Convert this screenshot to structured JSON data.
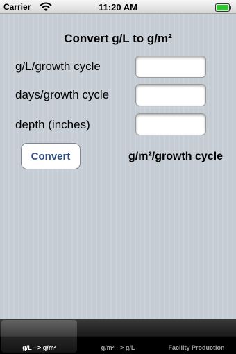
{
  "status_bar": {
    "carrier": "Carrier",
    "time": "11:20 AM",
    "icons": [
      "wifi-icon",
      "battery-icon"
    ]
  },
  "form": {
    "title": "Convert g/L to g/m²",
    "rows": [
      {
        "label": "g/L/growth cycle",
        "value": ""
      },
      {
        "label": "days/growth cycle",
        "value": ""
      },
      {
        "label": "depth (inches)",
        "value": ""
      }
    ],
    "convert_label": "Convert",
    "result_label": "g/m²/growth cycle"
  },
  "tab_bar": {
    "tabs": [
      {
        "label": "g/L --> g/m²",
        "selected": true
      },
      {
        "label": "g/m² --> g/L",
        "selected": false
      },
      {
        "label": "Facility Production",
        "selected": false
      }
    ]
  },
  "colors": {
    "background": "#c5ccd4",
    "button_text": "#324f85",
    "tab_bar": "#000000",
    "battery_fill": "#2fc72f"
  }
}
